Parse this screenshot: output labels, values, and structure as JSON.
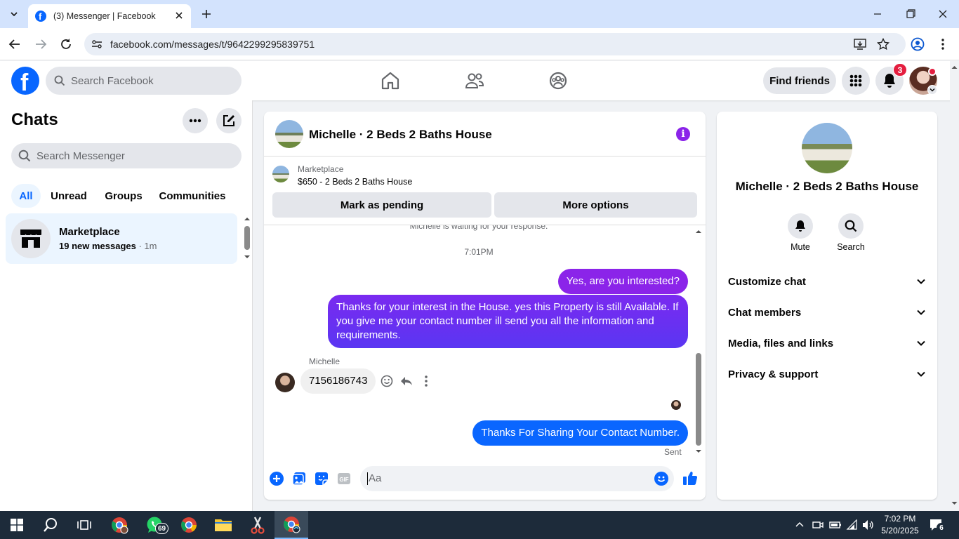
{
  "browser": {
    "tab_title": "(3) Messenger | Facebook",
    "url": "facebook.com/messages/t/9642299295839751"
  },
  "fb_header": {
    "search_placeholder": "Search Facebook",
    "find_friends": "Find friends",
    "notification_count": "3"
  },
  "sidebar": {
    "title": "Chats",
    "search_placeholder": "Search Messenger",
    "filters": [
      "All",
      "Unread",
      "Groups",
      "Communities"
    ],
    "active_filter": "All",
    "conversations": [
      {
        "name": "Marketplace",
        "preview": "19 new messages",
        "time": "· 1m"
      }
    ]
  },
  "chat": {
    "title": "Michelle · 2 Beds 2 Baths House",
    "listing_source": "Marketplace",
    "listing_title": "$650 - 2 Beds 2 Baths House",
    "mark_pending": "Mark as pending",
    "more_options": "More options",
    "waiting_note": "Michelle is waiting for your response.",
    "timestamp": "7:01PM",
    "messages": [
      {
        "from": "me",
        "text": "Yes, are you interested?"
      },
      {
        "from": "me",
        "text": "Thanks for your interest in the House. yes this Property is still Available. If you give me your contact number ill send you all the information and requirements."
      },
      {
        "from": "Michelle",
        "sender_label": "Michelle",
        "text": "7156186743"
      },
      {
        "from": "me",
        "text": "Thanks For Sharing Your Contact Number."
      }
    ],
    "status": "Sent",
    "composer_placeholder": "Aa"
  },
  "details": {
    "title": "Michelle · 2 Beds 2 Baths House",
    "mute": "Mute",
    "search": "Search",
    "sections": [
      "Customize chat",
      "Chat members",
      "Media, files and links",
      "Privacy & support"
    ]
  },
  "taskbar": {
    "time": "7:02 PM",
    "date": "5/20/2025",
    "whatsapp_badge": "69",
    "notif_badge": "6"
  },
  "colors": {
    "fb_blue": "#0866ff",
    "messenger_purple": "#8b24e9",
    "notif_red": "#e41e3f"
  }
}
